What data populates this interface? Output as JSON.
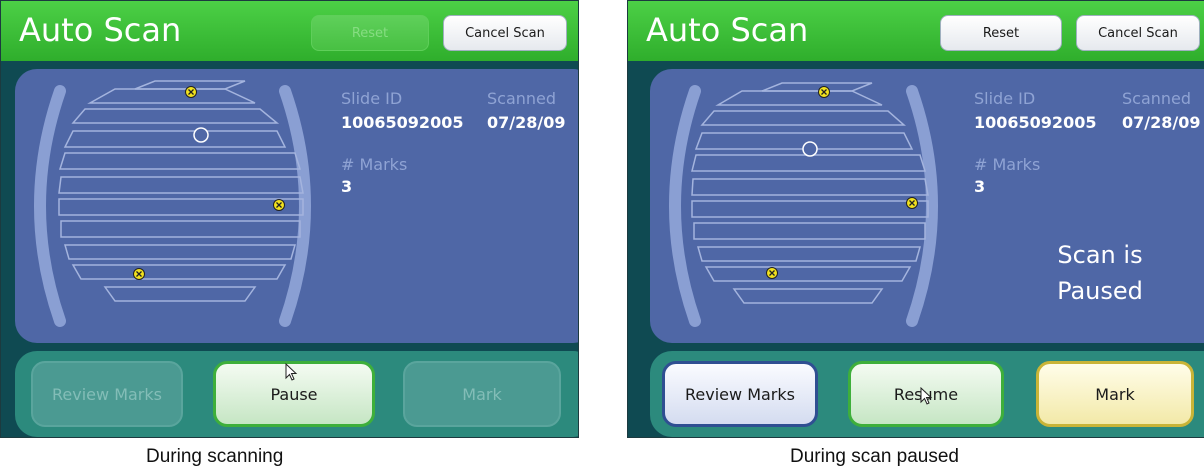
{
  "screens": [
    {
      "title": "Auto Scan",
      "reset_label": "Reset",
      "cancel_label": "Cancel Scan",
      "slide_id_label": "Slide ID",
      "slide_id_value": "10065092005",
      "scanned_label": "Scanned",
      "scanned_value": "07/28/09",
      "marks_label": "# Marks",
      "marks_value": "3",
      "review_label": "Review Marks",
      "primary_label": "Pause",
      "mark_label": "Mark",
      "caption": "During scanning"
    },
    {
      "title": "Auto Scan",
      "reset_label": "Reset",
      "cancel_label": "Cancel Scan",
      "slide_id_label": "Slide ID",
      "slide_id_value": "10065092005",
      "scanned_label": "Scanned",
      "scanned_value": "07/28/09",
      "marks_label": "# Marks",
      "marks_value": "3",
      "paused_line1": "Scan is",
      "paused_line2": "Paused",
      "review_label": "Review Marks",
      "primary_label": "Resume",
      "mark_label": "Mark",
      "caption": "During scan paused"
    }
  ],
  "colors": {
    "header_green": "#3cc038",
    "panel_blue": "#4f67a6",
    "bottom_teal": "#2c8a7d",
    "mark_yellow": "#f2e21e"
  },
  "icons": [
    "mark-icon",
    "scan-position-icon",
    "cursor-icon"
  ]
}
